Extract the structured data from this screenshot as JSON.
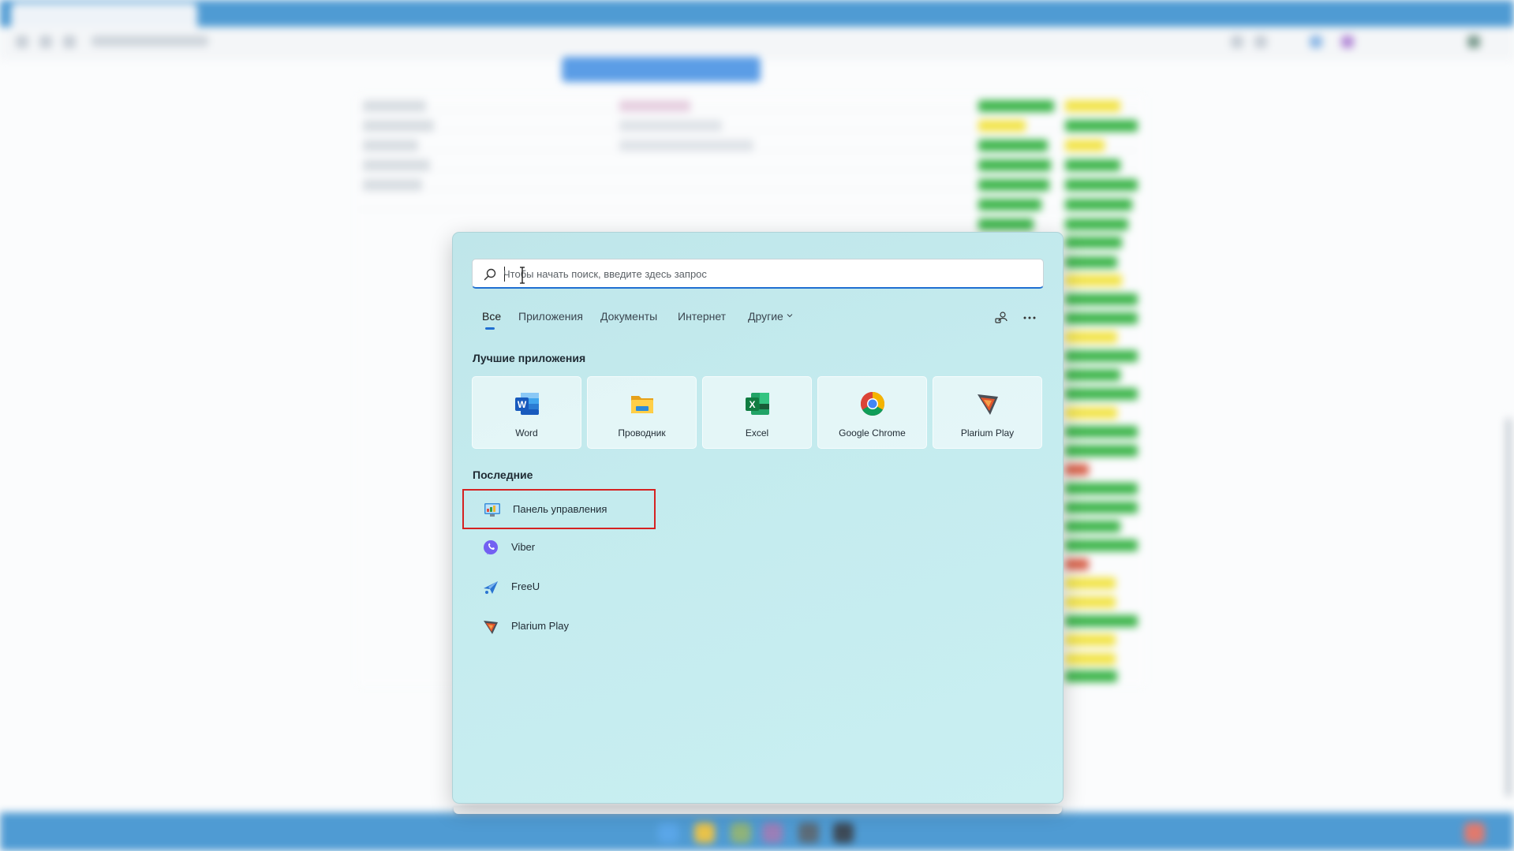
{
  "search": {
    "placeholder": "Чтобы начать поиск, введите здесь запрос",
    "value": ""
  },
  "tabs": [
    {
      "label": "Все",
      "active": true
    },
    {
      "label": "Приложения",
      "active": false
    },
    {
      "label": "Документы",
      "active": false
    },
    {
      "label": "Интернет",
      "active": false
    },
    {
      "label": "Другие",
      "active": false,
      "has_dropdown": true
    }
  ],
  "toolbar": {
    "share_icon": "share-account-icon",
    "more_icon": "more-options-icon"
  },
  "top_apps": {
    "title": "Лучшие приложения",
    "items": [
      {
        "label": "Word",
        "icon": "word-icon"
      },
      {
        "label": "Проводник",
        "icon": "file-explorer-icon"
      },
      {
        "label": "Excel",
        "icon": "excel-icon"
      },
      {
        "label": "Google Chrome",
        "icon": "chrome-icon"
      },
      {
        "label": "Plarium Play",
        "icon": "plarium-play-icon"
      }
    ]
  },
  "recent": {
    "title": "Последние",
    "items": [
      {
        "label": "Панель управления",
        "icon": "control-panel-icon",
        "highlighted": true
      },
      {
        "label": "Viber",
        "icon": "viber-icon",
        "highlighted": false
      },
      {
        "label": "FreeU",
        "icon": "freeu-icon",
        "highlighted": false
      },
      {
        "label": "Plarium Play",
        "icon": "plarium-play-icon",
        "highlighted": false
      }
    ]
  },
  "colors": {
    "accent": "#1f6fd1",
    "highlight_border": "#d52222",
    "panel_bg": "#c4ebee"
  }
}
